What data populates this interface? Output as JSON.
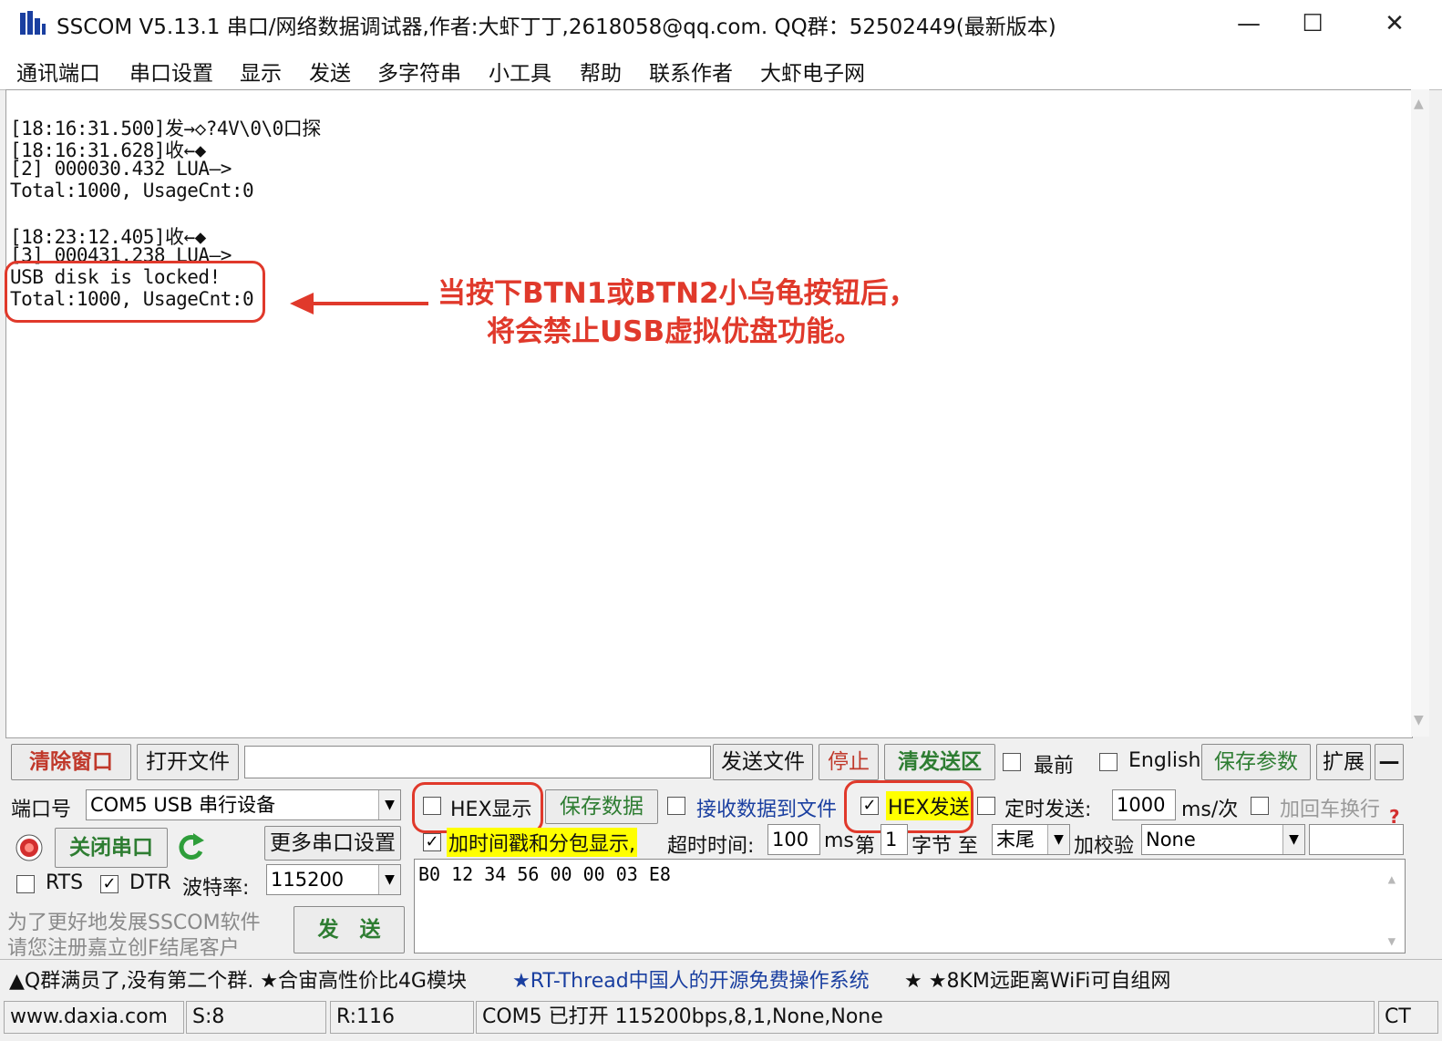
{
  "window": {
    "title": "SSCOM V5.13.1 串口/网络数据调试器,作者:大虾丁丁,2618058@qq.com. QQ群：52502449(最新版本)",
    "minimize": "—",
    "maximize": "☐",
    "close": "✕"
  },
  "menu": [
    "通讯端口",
    "串口设置",
    "显示",
    "发送",
    "多字符串",
    "小工具",
    "帮助",
    "联系作者",
    "大虾电子网"
  ],
  "receive": {
    "lines": [
      "[18:16:31.500]发→◇?4V\\0\\0口探",
      "[18:16:31.628]收←◆",
      "[2] 000030.432 LUA—>",
      "Total:1000, UsageCnt:0",
      "",
      "[18:23:12.405]收←◆",
      "[3] 000431.238 LUA—>",
      "USB disk is locked!",
      "Total:1000, UsageCnt:0"
    ]
  },
  "annotation": {
    "line1": "当按下BTN1或BTN2小乌龟按钮后，",
    "line2": "将会禁止USB虚拟优盘功能。",
    "color": "#e0392b"
  },
  "toolbar": {
    "clear": "清除窗口",
    "open_file": "打开文件",
    "file_path": "",
    "send_file": "发送文件",
    "stop": "停止",
    "clear_send": "清发送区",
    "topmost": "最前",
    "english": "English",
    "save_params": "保存参数",
    "expand": "扩展",
    "collapse": "—"
  },
  "port": {
    "label": "端口号",
    "value": "COM5 USB 串行设备",
    "close_port": "关闭串口",
    "more_settings": "更多串口设置",
    "rts": "RTS",
    "dtr": "DTR",
    "baud_label": "波特率:",
    "baud": "115200"
  },
  "options": {
    "hex_display": "HEX显示",
    "save_data": "保存数据",
    "recv_to_file": "接收数据到文件",
    "hex_send": "HEX发送",
    "timed_send": "定时发送:",
    "interval": "1000",
    "interval_unit": "ms/次",
    "add_crlf": "加回车换行",
    "timestamp": "加时间戳和分包显示,",
    "timeout_label": "超时时间:",
    "timeout": "100",
    "ms": "ms",
    "nth": "第",
    "nth_value": "1",
    "byte_label": "字节 至",
    "end": "末尾",
    "checksum_label": "加校验",
    "checksum": "None",
    "help": "?"
  },
  "send": {
    "data": "B0 12 34 56 00 00 03 E8",
    "button": "发　送"
  },
  "promo": {
    "line1": "为了更好地发展SSCOM软件",
    "line2": "请您注册嘉立创F结尾客户"
  },
  "ticker": {
    "part1": "▲Q群满员了,没有第二个群. ★合宙高性价比4G模块",
    "part2": "★RT-Thread中国人的开源免费操作系统",
    "part3": "★ ★8KM远距离WiFi可自组网"
  },
  "status": {
    "site": "www.daxia.com",
    "sent": "S:8",
    "received": "R:116",
    "port_status": "COM5 已打开  115200bps,8,1,None,None",
    "cts": "CT"
  }
}
